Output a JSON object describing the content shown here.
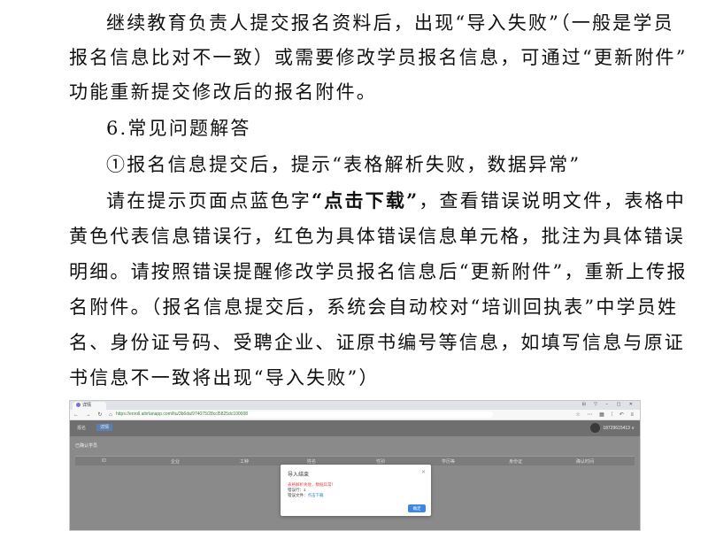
{
  "doc": {
    "p1_l1": "继续教育负责人提交报名资料后，出现“导入失败”（一般是学员",
    "p1_l2": "报名信息比对不一致）或需要修改学员报名信息，可通过“更新附件”",
    "p1_l3": "功能重新提交修改后的报名附件。",
    "section": "6.常见问题解答",
    "q1": "①报名信息提交后，提示“表格解析失败，数据异常”",
    "p2_l1_pre": "请在提示页面点蓝色字",
    "p2_l1_bold": "“点击下载”",
    "p2_l1_post": "，查看错误说明文件，表格中",
    "p2_l2": "黄色代表信息错误行，红色为具体错误信息单元格，批注为具体错误",
    "p2_l3": "明细。请按照错误提醒修改学员报名信息后“更新附件”，重新上传报",
    "p2_l4": "名附件。（报名信息提交后，系统会自动校对“培训回执表”中学员姓",
    "p2_l5": "名、身份证号码、受聘企业、证原书编号等信息，如填写信息与原证",
    "p2_l6": "书信息不一致将出现“导入失败”）"
  },
  "screenshot": {
    "tab_title": "详情",
    "window_controls": "⊟ ▽ − ▢ ✕",
    "nav_buttons": "← → ↻ ⌂",
    "url": "https://enroll.aihrlanapp.com/ltu/3b6da/974075/28ccl5825dc100008",
    "toolbar_icons": "☆ ⋯ ▦ ⁞ ↶ ≡",
    "app_brand": "报名",
    "app_crumb": "详情",
    "user_name": "18729615413 ∨",
    "section_title": "已确认学员",
    "columns": [
      "ID",
      "企业",
      "工种",
      "姓名",
      "性别",
      "学历等",
      "身份证",
      "确认时间"
    ],
    "modal": {
      "title": "导入结束",
      "close": "✕",
      "error": "表格解析失败，数据异常！",
      "count_label": "错误行：1",
      "file_label": "错误文件：",
      "file_link": "点击下载",
      "ok_button": "确定"
    }
  }
}
